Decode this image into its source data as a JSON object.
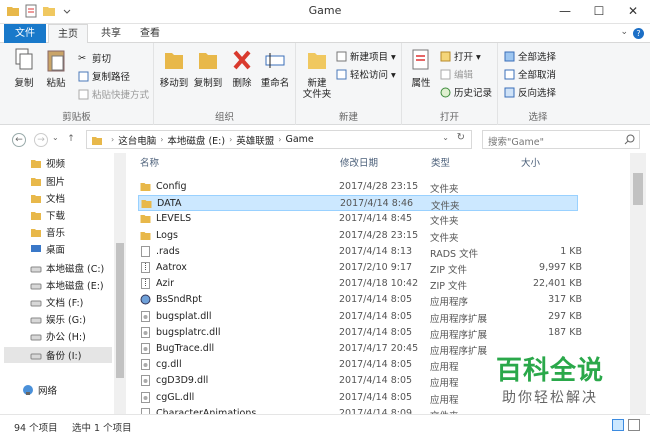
{
  "window": {
    "title": "Game"
  },
  "tabs": {
    "file": "文件",
    "home": "主页",
    "share": "共享",
    "view": "查看"
  },
  "ribbon": {
    "clipboard": {
      "label": "剪贴板",
      "copy": "复制",
      "paste": "粘贴",
      "cut": "剪切",
      "copy_path": "复制路径",
      "paste_shortcut": "粘贴快捷方式"
    },
    "organize": {
      "label": "组织",
      "move_to": "移动到",
      "copy_to": "复制到",
      "delete": "删除",
      "rename": "重命名"
    },
    "new": {
      "label": "新建",
      "new_folder_1": "新建",
      "new_folder_2": "文件夹",
      "new_item": "新建项目 ▾",
      "easy_access": "轻松访问 ▾"
    },
    "open": {
      "label": "打开",
      "properties": "属性",
      "open": "打开 ▾",
      "edit": "编辑",
      "history": "历史记录"
    },
    "select": {
      "label": "选择",
      "select_all": "全部选择",
      "select_none": "全部取消",
      "invert": "反向选择"
    }
  },
  "address": {
    "crumbs": [
      "这台电脑",
      "本地磁盘 (E:)",
      "英雄联盟",
      "Game"
    ],
    "search_placeholder": "搜索\"Game\""
  },
  "sidebar": {
    "items": [
      {
        "label": "视频",
        "icon": "video-icon"
      },
      {
        "label": "图片",
        "icon": "picture-icon"
      },
      {
        "label": "文档",
        "icon": "document-icon"
      },
      {
        "label": "下载",
        "icon": "download-icon"
      },
      {
        "label": "音乐",
        "icon": "music-icon"
      },
      {
        "label": "桌面",
        "icon": "desktop-icon"
      },
      {
        "label": "本地磁盘 (C:)",
        "icon": "drive-icon"
      },
      {
        "label": "本地磁盘 (E:)",
        "icon": "drive-icon"
      },
      {
        "label": "文档 (F:)",
        "icon": "drive-icon"
      },
      {
        "label": "娱乐 (G:)",
        "icon": "drive-icon"
      },
      {
        "label": "办公 (H:)",
        "icon": "drive-icon"
      },
      {
        "label": "备份 (I:)",
        "icon": "drive-icon"
      },
      {
        "label": "网络",
        "icon": "network-icon"
      }
    ]
  },
  "columns": {
    "name": "名称",
    "date": "修改日期",
    "type": "类型",
    "size": "大小"
  },
  "files": [
    {
      "name": "Config",
      "date": "2017/4/28 23:15",
      "type": "文件夹",
      "size": "",
      "kind": "folder"
    },
    {
      "name": "DATA",
      "date": "2017/4/14 8:46",
      "type": "文件夹",
      "size": "",
      "kind": "folder"
    },
    {
      "name": "LEVELS",
      "date": "2017/4/14 8:45",
      "type": "文件夹",
      "size": "",
      "kind": "folder"
    },
    {
      "name": "Logs",
      "date": "2017/4/28 23:15",
      "type": "文件夹",
      "size": "",
      "kind": "folder"
    },
    {
      "name": ".rads",
      "date": "2017/4/14 8:13",
      "type": "RADS 文件",
      "size": "1 KB",
      "kind": "file"
    },
    {
      "name": "Aatrox",
      "date": "2017/2/10 9:17",
      "type": "ZIP 文件",
      "size": "9,997 KB",
      "kind": "zip"
    },
    {
      "name": "Azir",
      "date": "2017/4/18 10:42",
      "type": "ZIP 文件",
      "size": "22,401 KB",
      "kind": "zip"
    },
    {
      "name": "BsSndRpt",
      "date": "2017/4/14 8:05",
      "type": "应用程序",
      "size": "317 KB",
      "kind": "exe"
    },
    {
      "name": "bugsplat.dll",
      "date": "2017/4/14 8:05",
      "type": "应用程序扩展",
      "size": "297 KB",
      "kind": "dll"
    },
    {
      "name": "bugsplatrc.dll",
      "date": "2017/4/14 8:05",
      "type": "应用程序扩展",
      "size": "187 KB",
      "kind": "dll"
    },
    {
      "name": "BugTrace.dll",
      "date": "2017/4/17 20:45",
      "type": "应用程序扩展",
      "size": "",
      "kind": "dll"
    },
    {
      "name": "cg.dll",
      "date": "2017/4/14 8:05",
      "type": "应用程",
      "size": "",
      "kind": "dll"
    },
    {
      "name": "cgD3D9.dll",
      "date": "2017/4/14 8:05",
      "type": "应用程",
      "size": "",
      "kind": "dll"
    },
    {
      "name": "cgGL.dll",
      "date": "2017/4/14 8:05",
      "type": "应用程",
      "size": "",
      "kind": "dll"
    },
    {
      "name": "CharacterAnimations",
      "date": "2017/4/14 8:09",
      "type": "文件夹",
      "size": "",
      "kind": "file"
    }
  ],
  "status": {
    "count": "94 个项目",
    "selected": "选中 1 个项目"
  },
  "watermark": {
    "line1": "百科全说",
    "line2": "助你轻松解决"
  },
  "colors": {
    "accent": "#1979ca",
    "selection": "#cce8ff",
    "folder": "#e8b84a"
  }
}
